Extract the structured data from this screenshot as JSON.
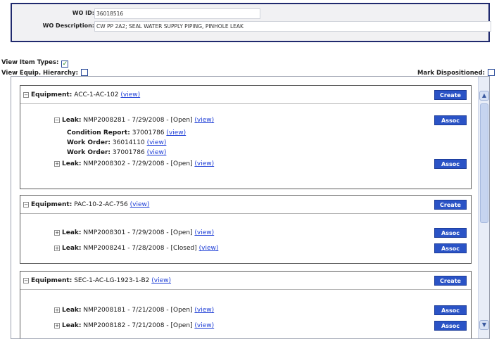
{
  "wo": {
    "id_label": "WO ID:",
    "id_value": "36018516",
    "desc_label": "WO Description:",
    "desc_value": "CW PP 2A2; SEAL WATER SUPPLY PIPING, PINHOLE LEAK"
  },
  "options": {
    "view_item_types": "View Item Types:",
    "view_item_types_checked": true,
    "view_equip_hierarchy": "View Equip. Hierarchy:",
    "view_equip_hierarchy_checked": false,
    "mark_dispositioned": "Mark Dispositioned:",
    "mark_dispositioned_checked": false
  },
  "labels": {
    "equipment": "Equipment:",
    "leak": "Leak:",
    "condition_report": "Condition Report:",
    "work_order": "Work Order:",
    "view": "(view)",
    "create": "Create",
    "assoc": "Assoc"
  },
  "equipment": [
    {
      "name": "ACC-1-AC-102",
      "l1_text": "NMP2008281 - 7/29/2008 - [Open]",
      "cr": "37001786",
      "wo1": "36014110",
      "wo2": "37001786",
      "l2_text": "NMP2008302 - 7/29/2008 - [Open]"
    },
    {
      "name": "PAC-10-2-AC-756",
      "l1_text": "NMP2008301 - 7/29/2008 - [Open]",
      "l2_text": "NMP2008241 - 7/28/2008 - [Closed]"
    },
    {
      "name": "SEC-1-AC-LG-1923-1-B2",
      "l1_text": "NMP2008181 - 7/21/2008 - [Open]",
      "l2_text": "NMP2008182 - 7/21/2008 - [Open]"
    }
  ],
  "colors": {
    "button_bg": "#2a53c6",
    "link": "#1a3bd6",
    "header_border": "#202a6e"
  }
}
